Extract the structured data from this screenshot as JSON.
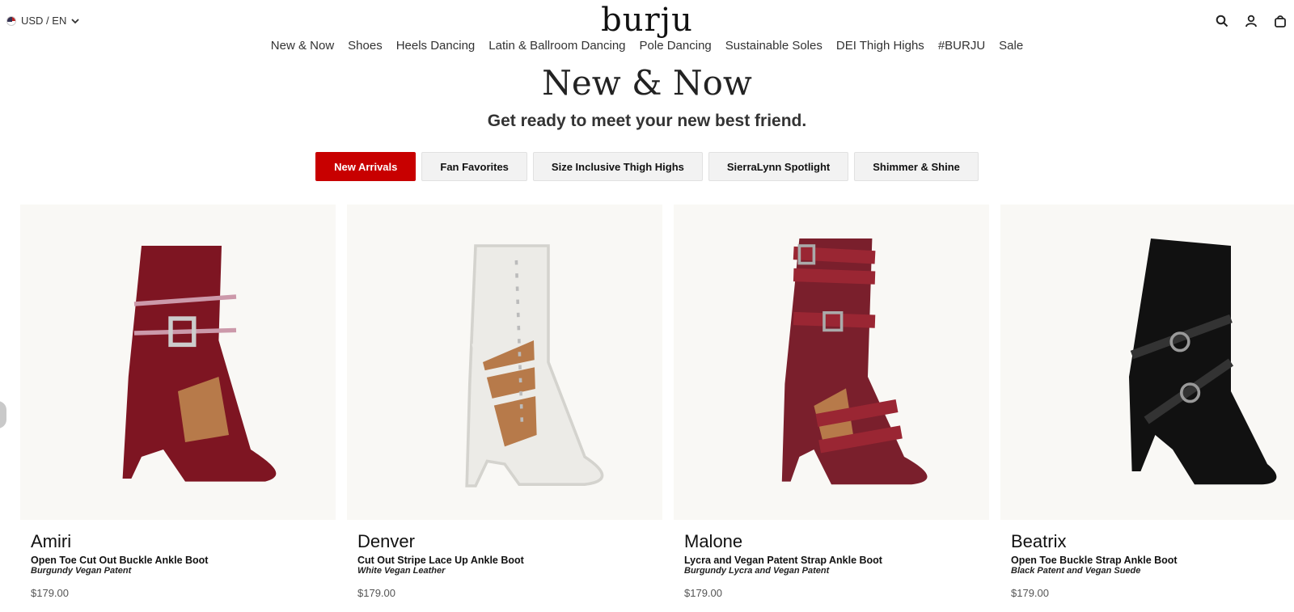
{
  "header": {
    "currency": "USD / EN",
    "logo": "burju",
    "icons": [
      "search-icon",
      "account-icon",
      "cart-icon"
    ]
  },
  "nav": [
    "New & Now",
    "Shoes",
    "Heels Dancing",
    "Latin & Ballroom Dancing",
    "Pole Dancing",
    "Sustainable Soles",
    "DEI Thigh Highs",
    "#BURJU",
    "Sale"
  ],
  "page": {
    "title": "New & Now",
    "subtitle": "Get ready to meet your new best friend."
  },
  "tabs": [
    "New Arrivals",
    "Fan Favorites",
    "Size Inclusive Thigh Highs",
    "SierraLynn Spotlight",
    "Shimmer & Shine"
  ],
  "active_tab": "New Arrivals",
  "colors": {
    "accent": "#c80000",
    "burgundy": "#7e1522",
    "white": "#ecebe7",
    "black": "#111111"
  },
  "products": [
    {
      "name": "Amiri",
      "description": "Open Toe Cut Out Buckle Ankle Boot",
      "variant": "Burgundy Vegan Patent",
      "price": "$179.00",
      "color": "#7e1522"
    },
    {
      "name": "Denver",
      "description": "Cut Out Stripe Lace Up Ankle Boot",
      "variant": "White Vegan Leather",
      "price": "$179.00",
      "color": "#ecebe7"
    },
    {
      "name": "Malone",
      "description": "Lycra and Vegan Patent Strap Ankle Boot",
      "variant": "Burgundy Lycra and Vegan Patent",
      "price": "$179.00",
      "color": "#7a1f2c"
    },
    {
      "name": "Beatrix",
      "description": "Open Toe Buckle Strap Ankle Boot",
      "variant": "Black Patent and Vegan Suede",
      "price": "$179.00",
      "color": "#111111"
    }
  ]
}
